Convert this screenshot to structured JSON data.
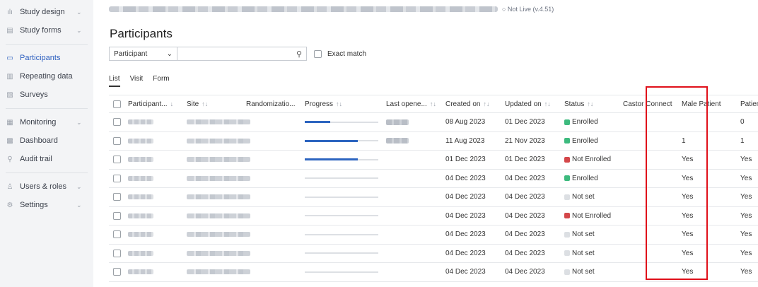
{
  "sidebar": {
    "items": [
      {
        "label": "Study design",
        "icon": "study-design-icon",
        "chevron": true,
        "active": false
      },
      {
        "label": "Study forms",
        "icon": "study-forms-icon",
        "chevron": true,
        "active": false
      },
      {
        "label": "Participants",
        "icon": "participants-icon",
        "chevron": false,
        "active": true
      },
      {
        "label": "Repeating data",
        "icon": "repeating-data-icon",
        "chevron": false,
        "active": false
      },
      {
        "label": "Surveys",
        "icon": "surveys-icon",
        "chevron": false,
        "active": false
      },
      {
        "label": "Monitoring",
        "icon": "monitoring-icon",
        "chevron": true,
        "active": false
      },
      {
        "label": "Dashboard",
        "icon": "dashboard-icon",
        "chevron": false,
        "active": false
      },
      {
        "label": "Audit trail",
        "icon": "audit-trail-icon",
        "chevron": false,
        "active": false
      },
      {
        "label": "Users & roles",
        "icon": "users-roles-icon",
        "chevron": true,
        "active": false
      },
      {
        "label": "Settings",
        "icon": "settings-icon",
        "chevron": true,
        "active": false
      }
    ]
  },
  "topbar": {
    "live_status": "○ Not Live (v.4.51)"
  },
  "page": {
    "title": "Participants"
  },
  "filter": {
    "select_value": "Participant",
    "search_value": "",
    "exact_match_label": "Exact match"
  },
  "tabs": [
    "List",
    "Visit",
    "Form"
  ],
  "table": {
    "headers": {
      "participant": "Participant...",
      "site": "Site",
      "randomization": "Randomizatio...",
      "progress": "Progress",
      "last_opened": "Last opene...",
      "created_on": "Created on",
      "updated_on": "Updated on",
      "status": "Status",
      "castor_connect": "Castor Connect",
      "male_patient": "Male Patient",
      "patient": "Patien"
    },
    "sort_icons": {
      "down": "↓",
      "updown": "↑↓"
    },
    "status_colors": {
      "Enrolled": "#3dba7e",
      "Not Enrolled": "#d4474a",
      "Not set": "#dcdfe3"
    },
    "rows": [
      {
        "progress": 0.35,
        "last_opened": true,
        "created_on": "08 Aug 2023",
        "updated_on": "01 Dec 2023",
        "status": "Enrolled",
        "male_patient": "",
        "patient": "0"
      },
      {
        "progress": 0.72,
        "last_opened": true,
        "created_on": "11 Aug 2023",
        "updated_on": "21 Nov 2023",
        "status": "Enrolled",
        "male_patient": "1",
        "patient": "1"
      },
      {
        "progress": 0.72,
        "last_opened": false,
        "created_on": "01 Dec 2023",
        "updated_on": "01 Dec 2023",
        "status": "Not Enrolled",
        "male_patient": "Yes",
        "patient": "Yes"
      },
      {
        "progress": 0,
        "last_opened": false,
        "created_on": "04 Dec 2023",
        "updated_on": "04 Dec 2023",
        "status": "Enrolled",
        "male_patient": "Yes",
        "patient": "Yes"
      },
      {
        "progress": 0,
        "last_opened": false,
        "created_on": "04 Dec 2023",
        "updated_on": "04 Dec 2023",
        "status": "Not set",
        "male_patient": "Yes",
        "patient": "Yes"
      },
      {
        "progress": 0,
        "last_opened": false,
        "created_on": "04 Dec 2023",
        "updated_on": "04 Dec 2023",
        "status": "Not Enrolled",
        "male_patient": "Yes",
        "patient": "Yes"
      },
      {
        "progress": 0,
        "last_opened": false,
        "created_on": "04 Dec 2023",
        "updated_on": "04 Dec 2023",
        "status": "Not set",
        "male_patient": "Yes",
        "patient": "Yes"
      },
      {
        "progress": 0,
        "last_opened": false,
        "created_on": "04 Dec 2023",
        "updated_on": "04 Dec 2023",
        "status": "Not set",
        "male_patient": "Yes",
        "patient": "Yes"
      },
      {
        "progress": 0,
        "last_opened": false,
        "created_on": "04 Dec 2023",
        "updated_on": "04 Dec 2023",
        "status": "Not set",
        "male_patient": "Yes",
        "patient": "Yes"
      }
    ]
  }
}
